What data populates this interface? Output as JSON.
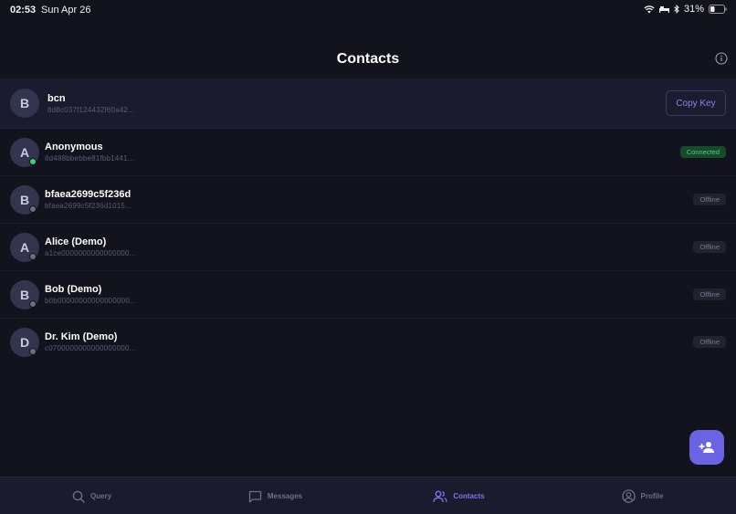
{
  "status_bar": {
    "time": "02:53",
    "date": "Sun Apr 26",
    "battery": "31%"
  },
  "header": {
    "title": "Contacts"
  },
  "my_identity": {
    "avatar_letter": "B",
    "name": "bcn",
    "key": "8d8c037f124432f60a42...",
    "copy_label": "Copy Key"
  },
  "contacts": [
    {
      "avatar_letter": "A",
      "name": "Anonymous",
      "key": "8d488bbebbe81fbb1441...",
      "status": "Connected",
      "online": true
    },
    {
      "avatar_letter": "B",
      "name": "bfaea2699c5f236d",
      "key": "bfaea2699c5f236d1015...",
      "status": "Offline",
      "online": false
    },
    {
      "avatar_letter": "A",
      "name": "Alice (Demo)",
      "key": "a1ce0000000000000000...",
      "status": "Offline",
      "online": false
    },
    {
      "avatar_letter": "B",
      "name": "Bob (Demo)",
      "key": "b0b00000000000000000...",
      "status": "Offline",
      "online": false
    },
    {
      "avatar_letter": "D",
      "name": "Dr. Kim (Demo)",
      "key": "c0700000000000000000...",
      "status": "Offline",
      "online": false
    }
  ],
  "tabs": [
    {
      "label": "Query",
      "icon": "search-icon",
      "active": false
    },
    {
      "label": "Messages",
      "icon": "message-icon",
      "active": false
    },
    {
      "label": "Contacts",
      "icon": "contacts-icon",
      "active": true
    },
    {
      "label": "Profile",
      "icon": "profile-icon",
      "active": false
    }
  ],
  "colors": {
    "background": "#13131e",
    "accent": "#6a64e4",
    "online": "#3ecf6e",
    "offline": "#6b6d80"
  }
}
